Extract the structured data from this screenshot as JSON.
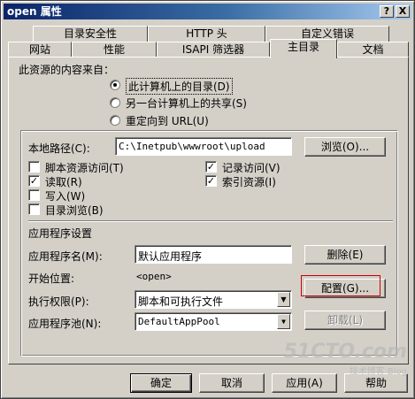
{
  "window": {
    "title": "open 属性",
    "help_btn": "?",
    "close_btn": "X"
  },
  "tabs_row1": [
    {
      "label": "目录安全性"
    },
    {
      "label": "HTTP 头"
    },
    {
      "label": "自定义错误"
    }
  ],
  "tabs_row2": [
    {
      "label": "网站"
    },
    {
      "label": "性能"
    },
    {
      "label": "ISAPI 筛选器"
    },
    {
      "label": "主目录"
    },
    {
      "label": "文档"
    }
  ],
  "source": {
    "heading": "此资源的内容来自：",
    "options": [
      {
        "label": "此计算机上的目录(D)",
        "selected": true
      },
      {
        "label": "另一台计算机上的共享(S)",
        "selected": false
      },
      {
        "label": "重定向到 URL(U)",
        "selected": false
      }
    ]
  },
  "local_path": {
    "label": "本地路径(C):",
    "value": "C:\\Inetpub\\wwwroot\\upload",
    "browse_btn": "浏览(O)..."
  },
  "permissions_left": [
    {
      "label": "脚本资源访问(T)",
      "checked": false
    },
    {
      "label": "读取(R)",
      "checked": true
    },
    {
      "label": "写入(W)",
      "checked": false
    },
    {
      "label": "目录浏览(B)",
      "checked": false
    }
  ],
  "permissions_right": [
    {
      "label": "记录访问(V)",
      "checked": true
    },
    {
      "label": "索引资源(I)",
      "checked": true
    }
  ],
  "app_settings": {
    "heading": "应用程序设置",
    "name_label": "应用程序名(M):",
    "name_value": "默认应用程序",
    "remove_btn": "删除(E)",
    "start_label": "开始位置:",
    "start_value": "<open>",
    "config_btn": "配置(G)...",
    "exec_label": "执行权限(P):",
    "exec_value": "脚本和可执行文件",
    "pool_label": "应用程序池(N):",
    "pool_value": "DefaultAppPool",
    "unload_btn": "卸载(L)"
  },
  "footer": {
    "ok": "确定",
    "cancel": "取消",
    "apply": "应用(A)",
    "help": "帮助"
  },
  "watermark": {
    "main": "51CTO.com",
    "sub": "技术博客  Blog"
  },
  "colors": {
    "highlight": "#cc0000",
    "titlebar_start": "#0a246a",
    "titlebar_end": "#a6caf0"
  }
}
